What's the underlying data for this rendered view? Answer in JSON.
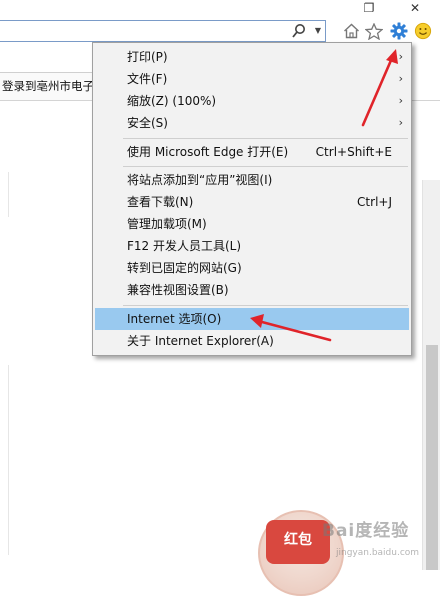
{
  "window": {
    "restore_glyph": "❐",
    "close_glyph": "✕"
  },
  "toolbar": {
    "address_value": "",
    "search_glyph": "⚲",
    "dropdown_glyph": "▼",
    "home_icon": "home-icon",
    "favorites_icon": "star-icon",
    "tools_icon": "gear-icon",
    "feedback_icon": "smiley-icon"
  },
  "tab": {
    "title": "登录到亳州市电子提"
  },
  "menu": {
    "items": [
      {
        "label": "打印(P)",
        "shortcut": "",
        "arrow": "›"
      },
      {
        "label": "文件(F)",
        "shortcut": "",
        "arrow": "›"
      },
      {
        "label": "缩放(Z) (100%)",
        "shortcut": "",
        "arrow": "›"
      },
      {
        "label": "安全(S)",
        "shortcut": "",
        "arrow": "›"
      },
      {
        "label": "使用 Microsoft Edge 打开(E)",
        "shortcut": "Ctrl+Shift+E",
        "arrow": ""
      },
      {
        "label": "将站点添加到“应用”视图(I)",
        "shortcut": "",
        "arrow": ""
      },
      {
        "label": "查看下载(N)",
        "shortcut": "Ctrl+J",
        "arrow": ""
      },
      {
        "label": "管理加载项(M)",
        "shortcut": "",
        "arrow": ""
      },
      {
        "label": "F12 开发人员工具(L)",
        "shortcut": "",
        "arrow": ""
      },
      {
        "label": "转到已固定的网站(G)",
        "shortcut": "",
        "arrow": ""
      },
      {
        "label": "兼容性视图设置(B)",
        "shortcut": "",
        "arrow": ""
      },
      {
        "label": "Internet 选项(O)",
        "shortcut": "",
        "arrow": "",
        "highlighted": true
      },
      {
        "label": "关于 Internet Explorer(A)",
        "shortcut": "",
        "arrow": ""
      }
    ]
  },
  "promo": {
    "envelope_label": "红包"
  },
  "watermark": {
    "text": "Bai度经验",
    "url": "jingyan.baidu.com"
  },
  "colors": {
    "highlight": "#99c9ef",
    "menu_bg": "#f2f2f2",
    "annotation_red": "#e0242a",
    "gear_blue": "#2f7fd6"
  }
}
